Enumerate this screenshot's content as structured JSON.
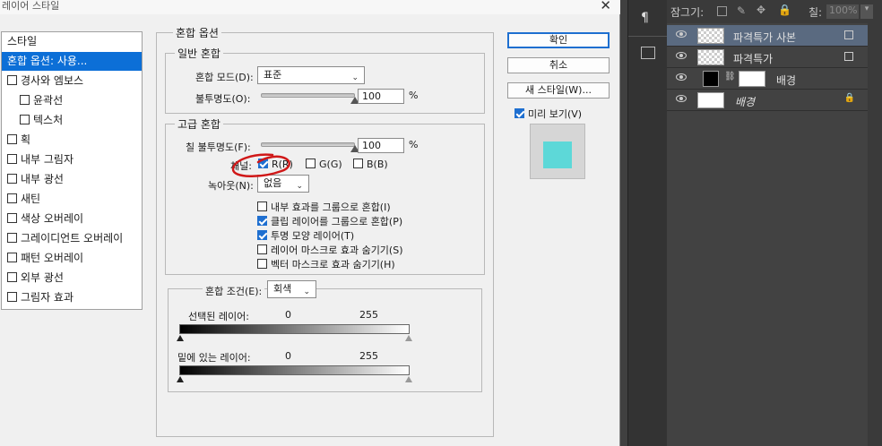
{
  "dialog": {
    "title": "레이어 스타일",
    "close_glyph": "✕",
    "styles_header": "스타일",
    "style_items": [
      {
        "label": "혼합 옵션: 사용...",
        "checkbox": false,
        "indent": false,
        "selected": true
      },
      {
        "label": "경사와 엠보스",
        "checkbox": true,
        "checked": false,
        "indent": false
      },
      {
        "label": "윤곽선",
        "checkbox": true,
        "checked": false,
        "indent": true
      },
      {
        "label": "텍스처",
        "checkbox": true,
        "checked": false,
        "indent": true
      },
      {
        "label": "획",
        "checkbox": true,
        "checked": false,
        "indent": false
      },
      {
        "label": "내부 그림자",
        "checkbox": true,
        "checked": false,
        "indent": false
      },
      {
        "label": "내부 광선",
        "checkbox": true,
        "checked": false,
        "indent": false
      },
      {
        "label": "새틴",
        "checkbox": true,
        "checked": false,
        "indent": false
      },
      {
        "label": "색상 오버레이",
        "checkbox": true,
        "checked": false,
        "indent": false
      },
      {
        "label": "그레이디언트 오버레이",
        "checkbox": true,
        "checked": false,
        "indent": false
      },
      {
        "label": "패턴 오버레이",
        "checkbox": true,
        "checked": false,
        "indent": false
      },
      {
        "label": "외부 광선",
        "checkbox": true,
        "checked": false,
        "indent": false
      },
      {
        "label": "그림자 효과",
        "checkbox": true,
        "checked": false,
        "indent": false
      }
    ],
    "blend_options_title": "혼합 옵션",
    "general": {
      "title": "일반 혼합",
      "blend_mode_label": "혼합 모드(D):",
      "blend_mode_value": "표준",
      "opacity_label": "불투명도(O):",
      "opacity_value": "100",
      "opacity_fraction": 1.0,
      "percent": "%"
    },
    "advanced": {
      "title": "고급 혼합",
      "fill_opacity_label": "칠 불투명도(F):",
      "fill_opacity_value": "100",
      "fill_fraction": 1.0,
      "percent": "%",
      "channels_label": "채널:",
      "channel_r": "R(R)",
      "channel_g": "G(G)",
      "channel_b": "B(B)",
      "knockout_label": "녹아웃(N):",
      "knockout_value": "없음",
      "options": [
        {
          "label": "내부 효과를 그룹으로 혼합(I)",
          "checked": false
        },
        {
          "label": "클립 레이어를 그룹으로 혼합(P)",
          "checked": true
        },
        {
          "label": "투명 모양 레이어(T)",
          "checked": true
        },
        {
          "label": "레이어 마스크로 효과 숨기기(S)",
          "checked": false
        },
        {
          "label": "벡터 마스크로 효과 숨기기(H)",
          "checked": false
        }
      ]
    },
    "blend_if": {
      "label": "혼합 조건(E):",
      "value": "회색",
      "this_layer_label": "선택된 레이어:",
      "underlying_label": "밑에 있는 레이어:",
      "low": "0",
      "high": "255"
    },
    "buttons": {
      "ok": "확인",
      "cancel": "취소",
      "new_style": "새 스타일(W)...",
      "preview": "미리 보기(V)"
    },
    "annotation_color": "#d01818",
    "preview_color": "#5dd8d8"
  },
  "layers_panel": {
    "lock_label": "잠그기:",
    "fill_label": "칠:",
    "fill_value": "100%",
    "layers": [
      {
        "name": "파격특가 사본",
        "active": true,
        "thumb": "smart"
      },
      {
        "name": "파격특가",
        "active": false,
        "thumb": "smart"
      },
      {
        "name": "배경",
        "active": false,
        "thumb": "mask"
      },
      {
        "name": "배경",
        "active": false,
        "thumb": "white",
        "italic": true,
        "locked": true
      }
    ]
  }
}
